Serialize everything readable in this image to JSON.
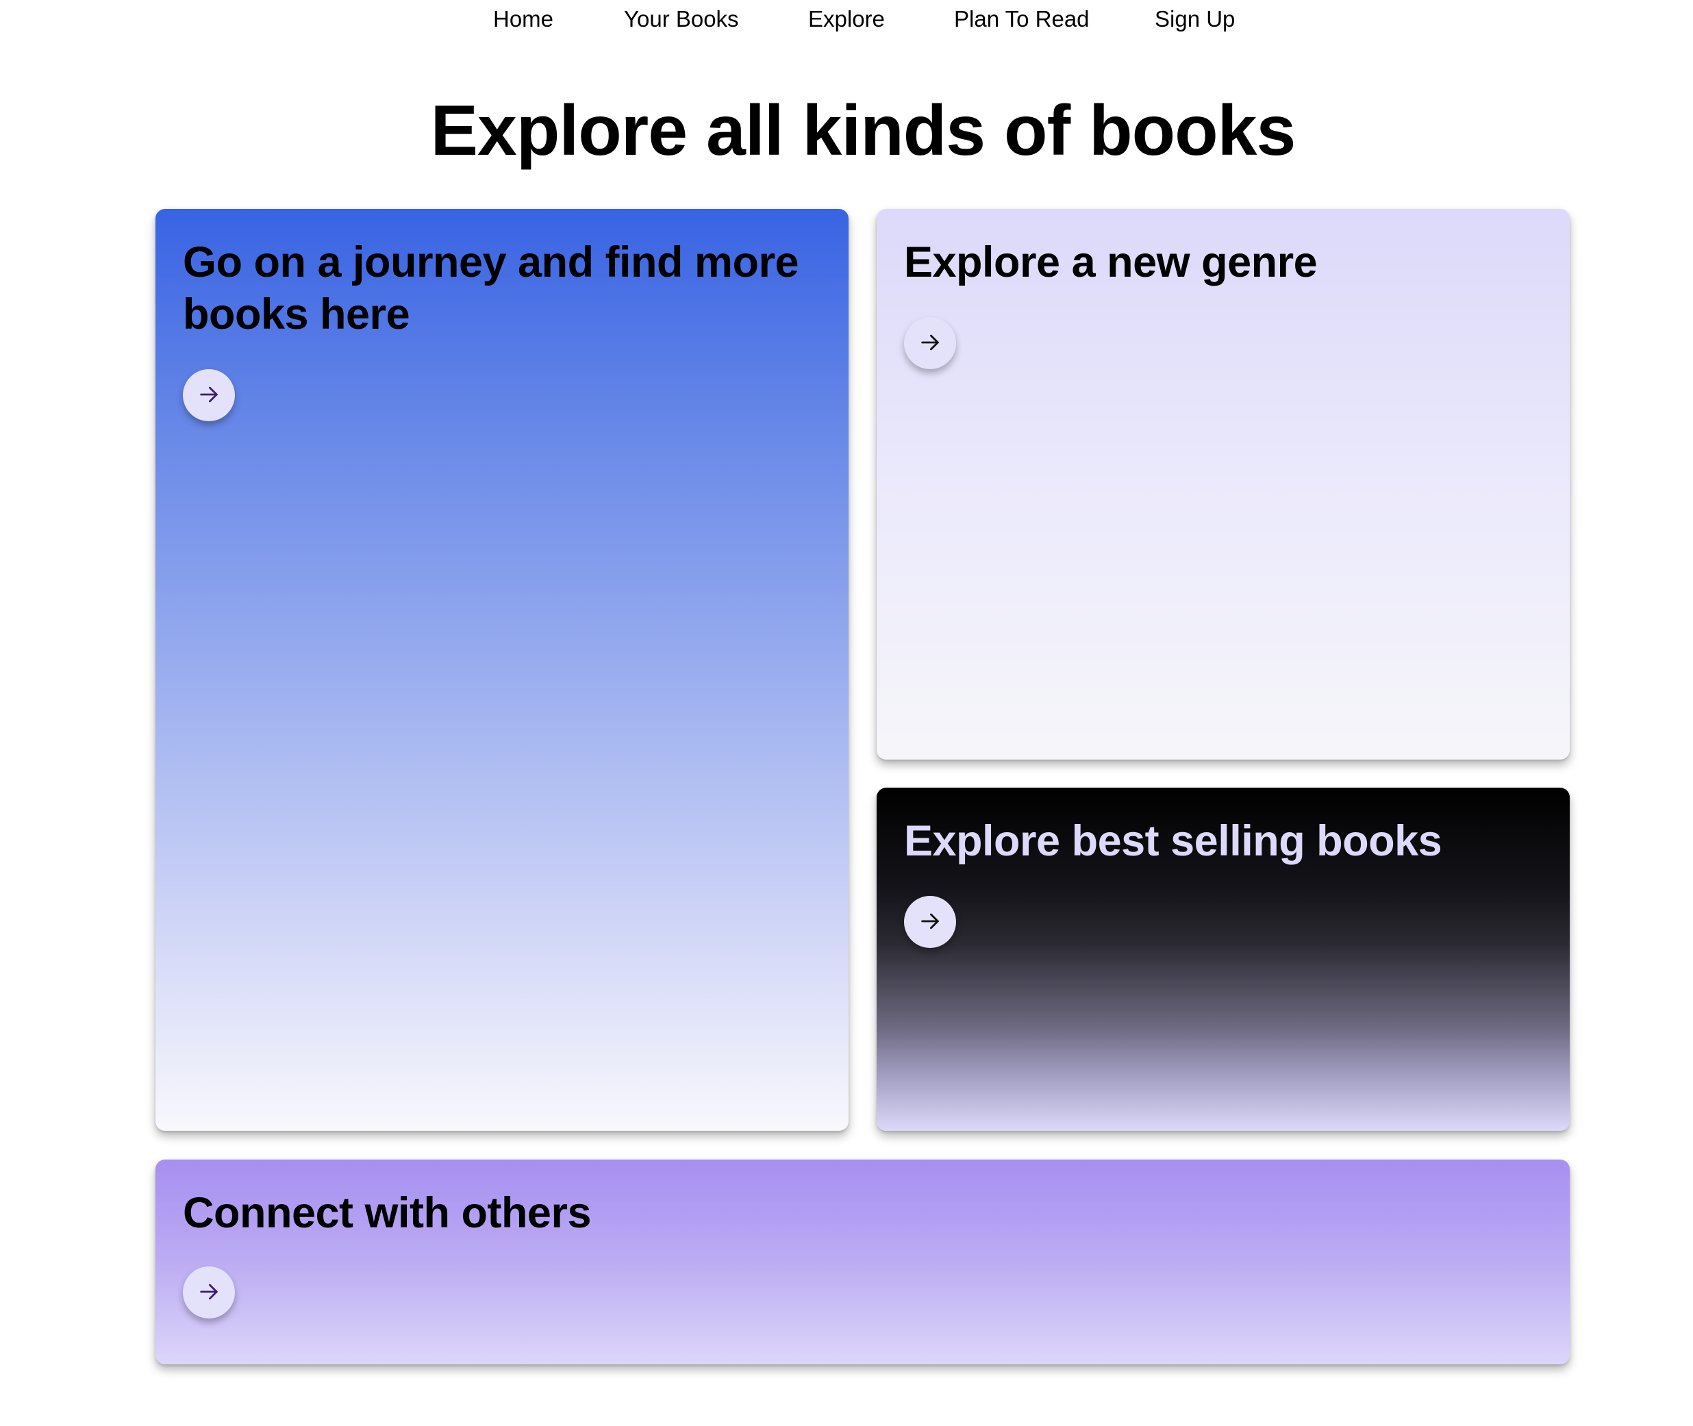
{
  "nav": {
    "items": [
      "Home",
      "Your Books",
      "Explore",
      "Plan To Read",
      "Sign Up"
    ]
  },
  "page": {
    "title": "Explore all kinds of books"
  },
  "cards": {
    "journey": {
      "heading": "Go on a journey and find more books here",
      "icon": "arrow-right-icon"
    },
    "genre": {
      "heading": "Explore a new genre",
      "icon": "arrow-right-icon"
    },
    "bestselling": {
      "heading": "Explore best selling books",
      "icon": "arrow-right-icon"
    },
    "connect": {
      "heading": "Connect with others",
      "icon": "arrow-right-icon"
    }
  },
  "colors": {
    "journey_top": "#3863e3",
    "genre_top": "#dcd9fa",
    "bestselling_top": "#000000",
    "connect_top": "#a68ff0",
    "arrow_button_bg": "#e4e1fa",
    "arrow_stroke": "#3b1f6e"
  }
}
